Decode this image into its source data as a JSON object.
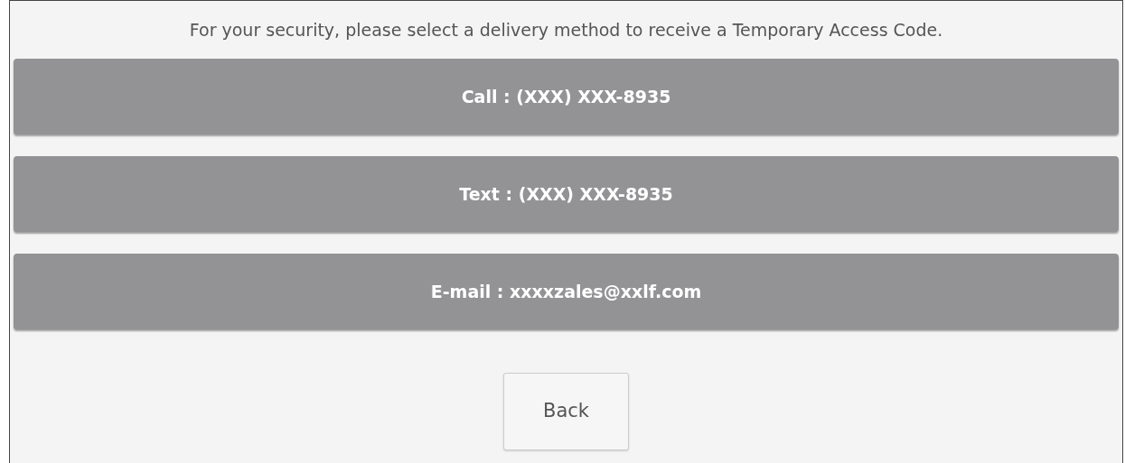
{
  "instruction": "For your security, please select a delivery method to receive a Temporary Access Code.",
  "delivery_options": [
    {
      "label": "Call : (XXX) XXX-8935"
    },
    {
      "label": "Text : (XXX) XXX-8935"
    },
    {
      "label": "E-mail : xxxxzales@xxlf.com"
    }
  ],
  "back_button": {
    "label": "Back"
  }
}
